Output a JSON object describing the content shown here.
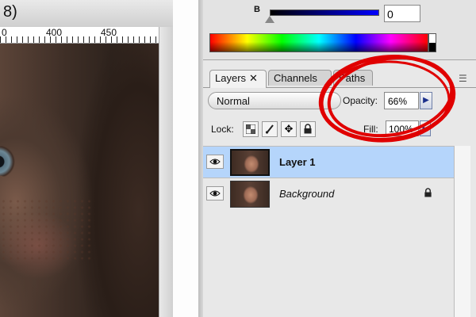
{
  "document": {
    "title_fragment": "8)",
    "ruler_labels": [
      "0",
      "400",
      "450"
    ]
  },
  "color_panel": {
    "channel_label": "B",
    "channel_value": "0"
  },
  "layers_panel": {
    "tabs": [
      {
        "label": "Layers",
        "active": true
      },
      {
        "label": "Channels",
        "active": false
      },
      {
        "label": "Paths",
        "active": false
      }
    ],
    "blend_mode": "Normal",
    "opacity_label": "Opacity:",
    "opacity_value": "66%",
    "lock_label": "Lock:",
    "fill_label": "Fill:",
    "fill_value": "100%",
    "layers": [
      {
        "name": "Layer 1",
        "selected": true,
        "visible": true,
        "locked": false
      },
      {
        "name": "Background",
        "selected": false,
        "visible": true,
        "locked": true
      }
    ]
  },
  "icons": {
    "visibility": "eye-icon",
    "lock_transparent": "checkerboard-icon",
    "lock_image": "brush-icon",
    "lock_position": "move-arrows-icon",
    "lock_all": "padlock-icon",
    "close": "close-icon",
    "menu": "panel-menu-icon",
    "dropdown": "triangle-right-icon"
  },
  "colors": {
    "selection_blue": "#b5d5fb",
    "annotation_red": "#e00000",
    "panel_gray": "#e8e8e8"
  }
}
